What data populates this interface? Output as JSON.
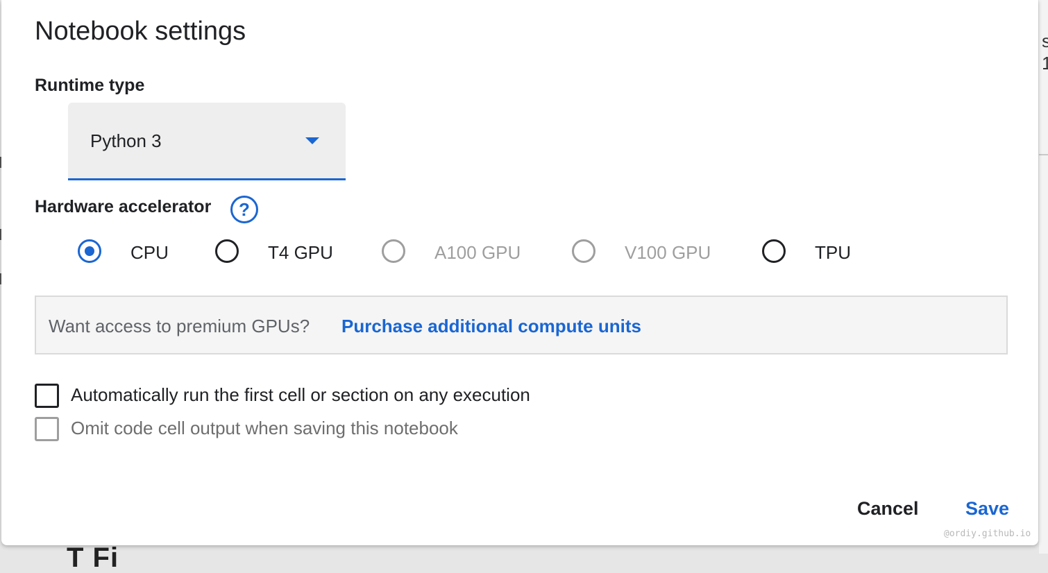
{
  "dialog": {
    "title": "Notebook settings",
    "runtime_label": "Runtime type",
    "runtime_value": "Python 3",
    "hardware_label": "Hardware accelerator",
    "help_glyph": "?",
    "accelerators": [
      {
        "label": "CPU",
        "state": "selected"
      },
      {
        "label": "T4 GPU",
        "state": "enabled"
      },
      {
        "label": "A100 GPU",
        "state": "disabled"
      },
      {
        "label": "V100 GPU",
        "state": "disabled"
      },
      {
        "label": "TPU",
        "state": "enabled"
      }
    ],
    "promo_text": "Want access to premium GPUs?",
    "promo_link": "Purchase additional compute units",
    "checkboxes": [
      {
        "label": "Automatically run the first cell or section on any execution",
        "checked": false,
        "disabled": false
      },
      {
        "label": "Omit code cell output when saving this notebook",
        "checked": false,
        "disabled": true
      }
    ],
    "cancel_label": "Cancel",
    "save_label": "Save"
  },
  "background": {
    "right_fragments": [
      "s",
      "1"
    ],
    "bottom_text": "T    Fi"
  },
  "watermark": "@ordiy.github.io",
  "colors": {
    "accent": "#1a66d2",
    "text": "#202124",
    "disabled": "#9e9e9e",
    "promo_bg": "#f5f5f5"
  }
}
